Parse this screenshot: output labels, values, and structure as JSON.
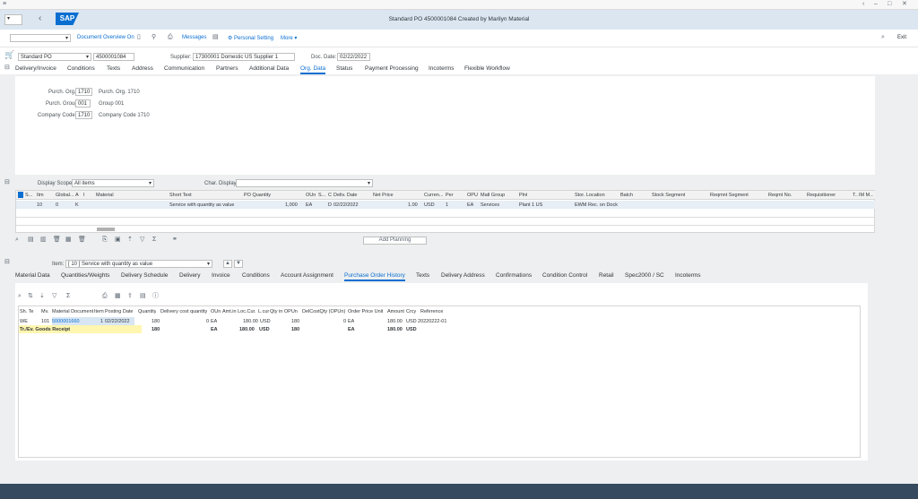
{
  "window": {
    "title": "Standard PO 4500001084 Created by Marilyn Material",
    "logo": "SAP"
  },
  "toolbar": {
    "items": [
      "Document Overview On",
      "Messages",
      "Personal Setting",
      "More"
    ],
    "exit": "Exit"
  },
  "header": {
    "doc_type": "Standard PO",
    "po_number": "4500001084",
    "supplier_label": "Supplier:",
    "supplier_value": "17300001 Domestic US Supplier 1",
    "doc_date_label": "Doc. Date:",
    "doc_date_value": "02/22/2022",
    "tabs": [
      "Delivery/Invoice",
      "Conditions",
      "Texts",
      "Address",
      "Communication",
      "Partners",
      "Additional Data",
      "Org. Data",
      "Status",
      "Payment Processing",
      "Incoterms",
      "Flexible Workflow"
    ],
    "active_tab": "Org. Data"
  },
  "org_data": {
    "purch_org_label": "Purch. Org.:",
    "purch_org_value": "1710",
    "purch_org_desc": "Purch. Org. 1710",
    "purch_group_label": "Purch. Group:",
    "purch_group_value": "001",
    "purch_group_desc": "Group 001",
    "company_code_label": "Company Code:",
    "company_code_value": "1710",
    "company_code_desc": "Company Code 1710"
  },
  "items": {
    "display_scope_label": "Display Scope:",
    "display_scope_value": "All items",
    "char_display_label": "Char. Display:",
    "columns": [
      "S...",
      "Itm",
      "Global...",
      "A",
      "I",
      "Material",
      "Short Text",
      "PO Quantity",
      "OUn",
      "S...",
      "C",
      "Deliv. Date",
      "Net Price",
      "Curren...",
      "Per",
      "OPU",
      "Matl Group",
      "Plnt",
      "Stor. Location",
      "Batch",
      "Stock Segment",
      "Reqmnt Segment",
      "Reqmt No.",
      "Requisitioner",
      "T...",
      "IM M..."
    ],
    "row": {
      "itm": "10",
      "global": "0",
      "acct": "K",
      "short_text": "Service with quantity as value",
      "po_qty": "1,000",
      "oun": "EA",
      "c": "D",
      "deliv_date": "02/22/2022",
      "net_price": "1.00",
      "currency": "USD",
      "per": "1",
      "opu": "EA",
      "matl_group": "Services",
      "plnt": "Plant 1 US",
      "stor_loc": "EWM Rec. on Dock"
    },
    "add_planning": "Add Planning"
  },
  "item_detail": {
    "item_label": "Item:",
    "item_value": "[ 10 ] Service with quantity as value",
    "tabs": [
      "Material Data",
      "Quantities/Weights",
      "Delivery Schedule",
      "Delivery",
      "Invoice",
      "Conditions",
      "Account Assignment",
      "Purchase Order History",
      "Texts",
      "Delivery Address",
      "Confirmations",
      "Condition Control",
      "Retail",
      "Spec2000 / SC",
      "Incoterms"
    ],
    "active_tab": "Purchase Order History",
    "history_columns": [
      "Sh. Te",
      "Mv.",
      "Material Document",
      "Item",
      "Posting Date",
      "Quantity",
      "Delivery cost quantity",
      "OUn",
      "Amt.in Loc.Cur.",
      "L.cur",
      "Qty in OPUn",
      "DelCostQty (OPUn)",
      "Order Price Unit",
      "Amount",
      "Crcy",
      "Reference"
    ],
    "history_row": {
      "sh": "WE",
      "mv": "101",
      "mat_doc": "5000001660",
      "item": "1",
      "posting_date": "02/22/2022",
      "qty": "180",
      "del_cost_qty": "0",
      "oun": "EA",
      "amt": "180.00",
      "lcur": "USD",
      "qty_opun": "180",
      "delcost_opun": "0",
      "opu": "EA",
      "amount": "180.00",
      "crcy": "USD",
      "reference": "20220222-01"
    },
    "total_row": {
      "label": "Tr./Ev. Goods Receipt",
      "qty": "180",
      "oun": "EA",
      "amt": "180.00",
      "lcur": "USD",
      "qty_opun": "180",
      "opu": "EA",
      "amount": "180.00",
      "crcy": "USD"
    }
  }
}
